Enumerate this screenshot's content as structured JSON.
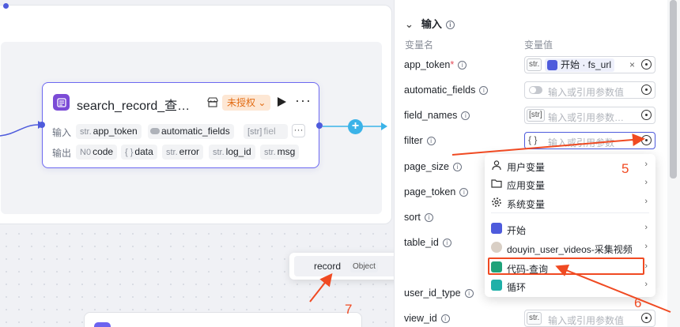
{
  "node": {
    "title": "search_record_查…",
    "auth_badge": "未授权",
    "auth_chevron": "⌄",
    "input_label": "输入",
    "output_label": "输出",
    "inputs": [
      {
        "type": "str.",
        "name": "app_token"
      },
      {
        "type": "",
        "name": "automatic_fields"
      },
      {
        "type": "[str]",
        "name": "fiel"
      }
    ],
    "more_tags": "···",
    "outputs": [
      {
        "type": "N0",
        "name": "code"
      },
      {
        "type": "{ }",
        "name": "data"
      },
      {
        "type": "str.",
        "name": "error"
      },
      {
        "type": "str.",
        "name": "log_id"
      },
      {
        "type": "str.",
        "name": "msg"
      }
    ],
    "more": "···",
    "plus": "+"
  },
  "record_popover": {
    "name": "record",
    "type": "Object"
  },
  "panel": {
    "section_title": "输入",
    "collapse_chevron": "⌄",
    "col_name": "变量名",
    "col_value": "变量值",
    "fields": [
      {
        "name": "app_token",
        "required": true
      },
      {
        "name": "automatic_fields"
      },
      {
        "name": "field_names"
      },
      {
        "name": "filter"
      },
      {
        "name": "page_size"
      },
      {
        "name": "page_token"
      },
      {
        "name": "sort"
      },
      {
        "name": "table_id"
      },
      {
        "name": ""
      },
      {
        "name": "user_id_type"
      },
      {
        "name": "view_id"
      }
    ],
    "app_token_ref": "开始 · fs_url",
    "app_token_type": "str.",
    "close": "×",
    "placeholders": {
      "automatic_fields": "输入或引用参数值",
      "field_names": "输入或引用参数…",
      "filter": "输入或引用参数",
      "view_id": "输入或引用参数值"
    },
    "type_badges": {
      "field_names": "[str]",
      "filter": "{ }",
      "view_id": "str."
    }
  },
  "menu": {
    "items": [
      {
        "label": "用户变量",
        "icon": "user-icon"
      },
      {
        "label": "应用变量",
        "icon": "folder-icon"
      },
      {
        "label": "系统变量",
        "icon": "gear-icon"
      },
      {
        "label": "开始",
        "icon": "start-node-icon"
      },
      {
        "label": "douyin_user_videos-采集视频",
        "icon": "douyin-icon"
      },
      {
        "label": "代码-查询",
        "icon": "code-icon"
      },
      {
        "label": "循环",
        "icon": "loop-icon"
      }
    ],
    "chevron": "›"
  },
  "annotations": {
    "a5": "5",
    "a6": "6",
    "a7": "7"
  },
  "colors": {
    "accent": "#4e5bdc",
    "annotation": "#f04a22",
    "auth_bg": "#fde7d4",
    "auth_text": "#e26b12",
    "node_icon": "#7b4bd6"
  }
}
